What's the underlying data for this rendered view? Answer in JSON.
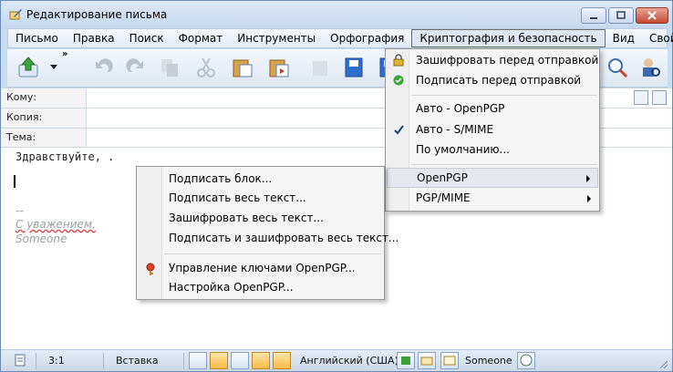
{
  "window": {
    "title": "Редактирование письма"
  },
  "menubar": {
    "items": [
      "Письмо",
      "Правка",
      "Поиск",
      "Формат",
      "Инструменты",
      "Орфография",
      "Криптография и безопасность",
      "Вид",
      "Свойства"
    ]
  },
  "headers": {
    "to_label": "Кому:",
    "cc_label": "Копия:",
    "subject_label": "Тема:"
  },
  "editor": {
    "greeting": "Здравствуйте, .",
    "sig_dash": "--",
    "sig_regards": "С уважением,",
    "sig_name": "Someone"
  },
  "crypto_menu": {
    "encrypt_before_send": "Зашифровать перед отправкой",
    "sign_before_send": "Подписать перед отправкой",
    "auto_openpgp": "Авто - OpenPGP",
    "auto_smime": "Авто - S/MIME",
    "default": "По умолчанию...",
    "openpgp": "OpenPGP",
    "pgp_mime": "PGP/MIME",
    "checked_item": "auto_smime"
  },
  "openpgp_submenu": {
    "sign_block": "Подписать блок...",
    "sign_all": "Подписать весь текст...",
    "encrypt_all": "Зашифровать весь текст...",
    "sign_encrypt_all": "Подписать и зашифровать весь текст...",
    "key_management": "Управление ключами OpenPGP...",
    "settings": "Настройка OpenPGP..."
  },
  "statusbar": {
    "position": "3:1",
    "insert_mode": "Вставка",
    "language": "Английский (США)",
    "identity": "Someone"
  },
  "colors": {
    "accent": "#c9dcf0",
    "menu_highlight": "#e4e8ee"
  }
}
